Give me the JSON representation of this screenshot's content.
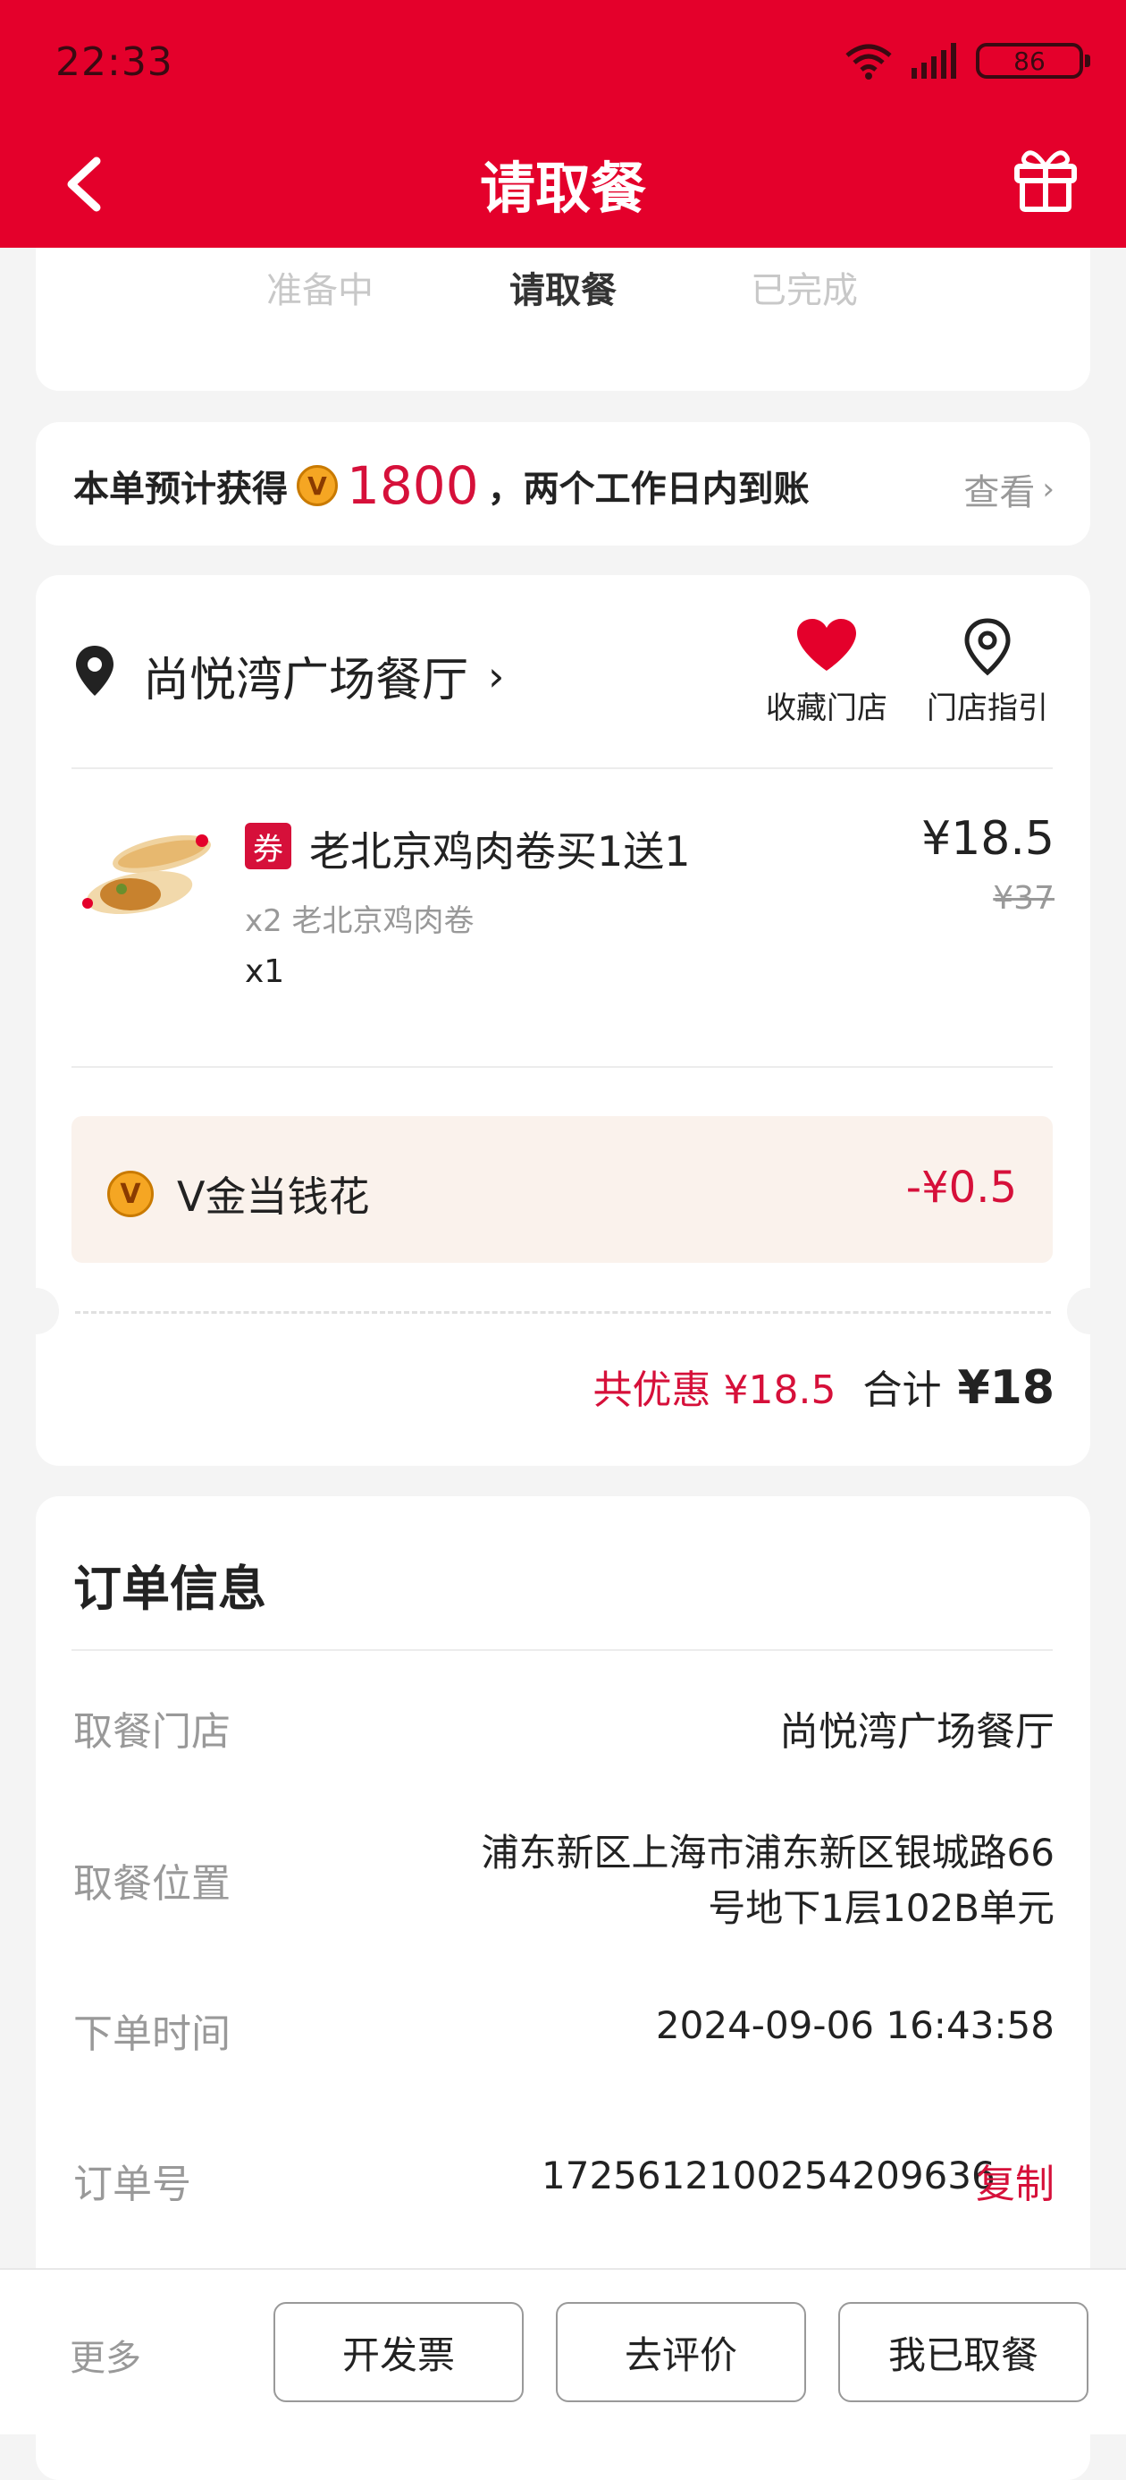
{
  "status": {
    "time": "22:33",
    "battery": "86"
  },
  "header": {
    "title": "请取餐"
  },
  "steps": [
    "准备中",
    "请取餐",
    "已完成"
  ],
  "points": {
    "prefix": "本单预计获得",
    "badge": "V",
    "amount": "1800",
    "suffix": "，两个工作日内到账",
    "link": "查看"
  },
  "store": {
    "name": "尚悦湾广场餐厅",
    "favorite_label": "收藏门店",
    "guide_label": "门店指引"
  },
  "item": {
    "coupon_tag": "券",
    "name": "老北京鸡肉卷买1送1",
    "detail": "x2 老北京鸡肉卷",
    "qty": "x1",
    "price": "¥18.5",
    "original_price": "¥37"
  },
  "vgold": {
    "label": "V金当钱花",
    "amount": "-¥0.5"
  },
  "totals": {
    "discount": "共优惠 ¥18.5",
    "total_label": "合计",
    "total": "¥18"
  },
  "order_info": {
    "title": "订单信息",
    "rows": [
      {
        "label": "取餐门店",
        "value": "尚悦湾广场餐厅"
      },
      {
        "label": "取餐位置",
        "value_line1": "浦东新区上海市浦东新区银城路66",
        "value_line2": "号地下1层102B单元"
      },
      {
        "label": "下单时间",
        "value": "2024-09-06 16:43:58"
      },
      {
        "label": "订单号",
        "value": "1725612100254209636",
        "action": "复制"
      }
    ]
  },
  "bottom": {
    "more": "更多",
    "invoice": "开发票",
    "review": "去评价",
    "picked": "我已取餐"
  },
  "colors": {
    "brand_red": "#e4002b",
    "price_red": "#d6103a",
    "vgold_bg": "#faf2ec"
  }
}
